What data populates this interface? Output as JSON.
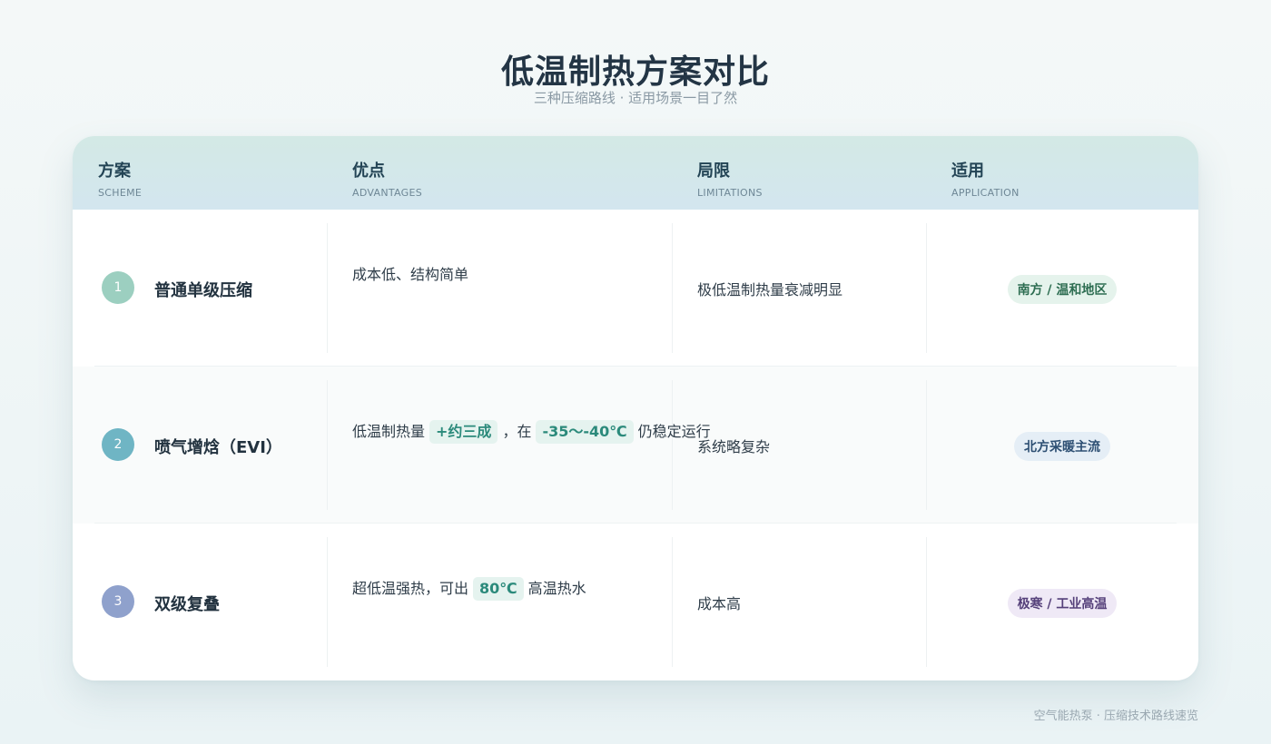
{
  "header": {
    "title": "低温制热方案对比",
    "subtitle": "三种压缩路线 · 适用场景一目了然"
  },
  "table": {
    "columns": [
      {
        "zh": "方案",
        "en": "SCHEME"
      },
      {
        "zh": "优点",
        "en": "ADVANTAGES"
      },
      {
        "zh": "局限",
        "en": "LIMITATIONS"
      },
      {
        "zh": "适用",
        "en": "APPLICATION"
      }
    ],
    "rows": [
      {
        "number": "1",
        "scheme": "普通单级压缩",
        "advantage": {
          "text": "成本低、结构简单"
        },
        "limitation": "极低温制热量衰减明显",
        "application": "南方 / 温和地区"
      },
      {
        "number": "2",
        "scheme": "喷气增焓（EVI）",
        "advantage": {
          "pre": "低温制热量",
          "hl1": "+约三成",
          "mid": "，在",
          "hl2": "-35～-40℃",
          "post": "仍稳定运行"
        },
        "limitation": "系统略复杂",
        "application": "北方采暖主流"
      },
      {
        "number": "3",
        "scheme": "双级复叠",
        "advantage": {
          "pre": "超低温强热，可出",
          "hl1": "80℃",
          "post": "高温热水"
        },
        "limitation": "成本高",
        "application": "极寒 / 工业高温"
      }
    ]
  },
  "colors": {
    "badge_1": "#9ccfc0",
    "badge_2": "#6fb5c4",
    "badge_3": "#8fa1cc",
    "tag_1_bg": "#e5f3ec",
    "tag_1_fg": "#2e6e52",
    "tag_2_bg": "#e5eef6",
    "tag_2_fg": "#2d4f73",
    "tag_3_bg": "#efe9f6",
    "tag_3_fg": "#55407a"
  },
  "footer": "空气能热泵 · 压缩技术路线速览"
}
